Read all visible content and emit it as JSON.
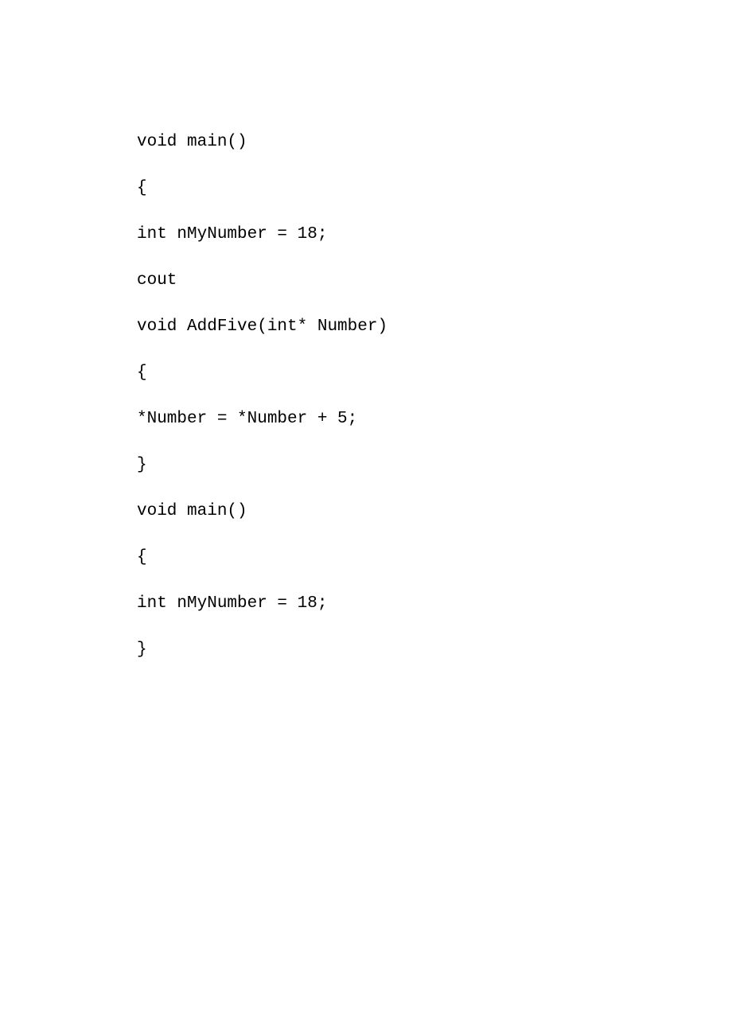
{
  "code": {
    "lines": [
      "void main()",
      "{",
      "int nMyNumber = 18;",
      "cout",
      "void AddFive(int* Number)",
      "{",
      "*Number = *Number + 5;",
      "}",
      "void main()",
      "{",
      "int nMyNumber = 18;",
      "}"
    ]
  }
}
